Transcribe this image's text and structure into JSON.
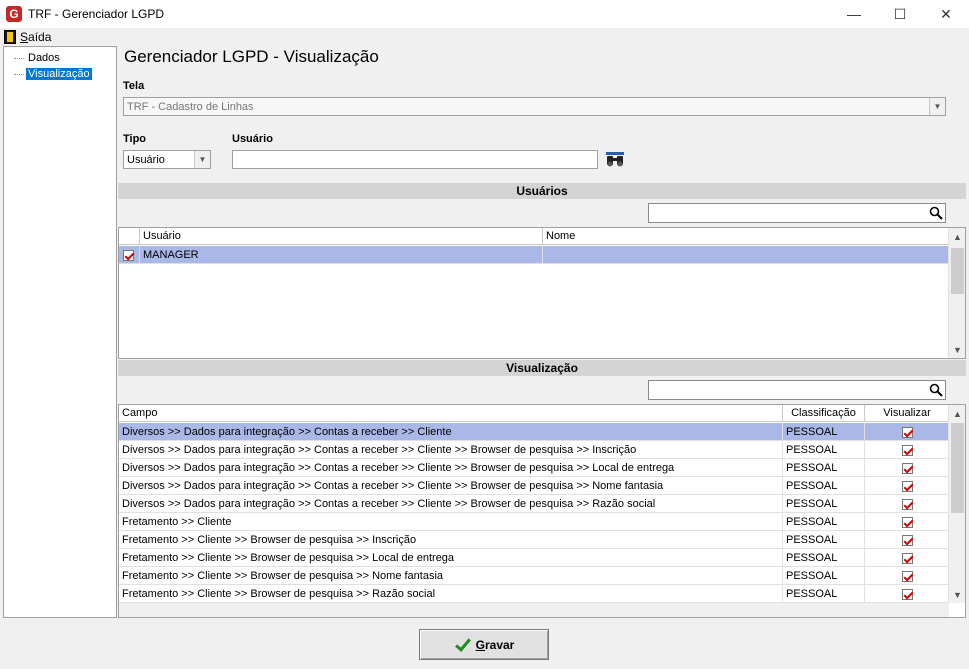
{
  "window": {
    "title": "TRF - Gerenciador LGPD",
    "app_icon_letter": "G",
    "min": "—",
    "max": "☐",
    "close": "✕"
  },
  "menu": {
    "exit_first": "S",
    "exit_rest": "aída"
  },
  "tree": {
    "items": [
      "Dados",
      "Visualização"
    ],
    "selected": "Visualização"
  },
  "heading": "Gerenciador LGPD - Visualização",
  "tela": {
    "label": "Tela",
    "value": "TRF - Cadastro de Linhas"
  },
  "tipo": {
    "label": "Tipo",
    "value": "Usuário"
  },
  "usuario_field": {
    "label": "Usuário",
    "value": ""
  },
  "usuarios_section": {
    "title": "Usuários",
    "search_value": "",
    "columns": [
      "Usuário",
      "Nome"
    ],
    "rows": [
      {
        "checked": true,
        "usuario": "MANAGER",
        "nome": ""
      }
    ]
  },
  "visualizacao_section": {
    "title": "Visualização",
    "search_value": "",
    "columns": [
      "Campo",
      "Classificação",
      "Visualizar"
    ],
    "rows": [
      {
        "campo": "Diversos >> Dados para integração >> Contas a receber >> Cliente",
        "classificacao": "PESSOAL",
        "visualizar": true
      },
      {
        "campo": "Diversos >> Dados para integração >> Contas a receber >> Cliente >> Browser de pesquisa >> Inscrição",
        "classificacao": "PESSOAL",
        "visualizar": true
      },
      {
        "campo": "Diversos >> Dados para integração >> Contas a receber >> Cliente >> Browser de pesquisa >> Local de entrega",
        "classificacao": "PESSOAL",
        "visualizar": true
      },
      {
        "campo": "Diversos >> Dados para integração >> Contas a receber >> Cliente >> Browser de pesquisa >> Nome fantasia",
        "classificacao": "PESSOAL",
        "visualizar": true
      },
      {
        "campo": "Diversos >> Dados para integração >> Contas a receber >> Cliente >> Browser de pesquisa >> Razão social",
        "classificacao": "PESSOAL",
        "visualizar": true
      },
      {
        "campo": "Fretamento >> Cliente",
        "classificacao": "PESSOAL",
        "visualizar": true
      },
      {
        "campo": "Fretamento >> Cliente >> Browser de pesquisa >> Inscrição",
        "classificacao": "PESSOAL",
        "visualizar": true
      },
      {
        "campo": "Fretamento >> Cliente >> Browser de pesquisa >> Local de entrega",
        "classificacao": "PESSOAL",
        "visualizar": true
      },
      {
        "campo": "Fretamento >> Cliente >> Browser de pesquisa >> Nome fantasia",
        "classificacao": "PESSOAL",
        "visualizar": true
      },
      {
        "campo": "Fretamento >> Cliente >> Browser de pesquisa >> Razão social",
        "classificacao": "PESSOAL",
        "visualizar": true
      }
    ]
  },
  "gravar": {
    "first": "G",
    "rest": "ravar"
  },
  "colors": {
    "selection_row": "#aab8e8",
    "tree_selection": "#0078d7",
    "check_red": "#d40000",
    "gravar_check": "#1a8f1a"
  }
}
